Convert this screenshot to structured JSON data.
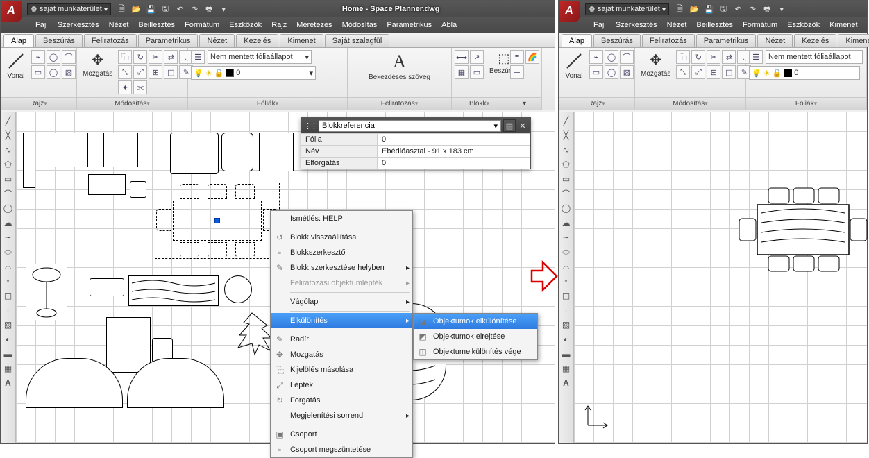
{
  "workspace_label": "saját munkaterület",
  "title": "Home - Space Planner.dwg",
  "menus": [
    "Fájl",
    "Szerkesztés",
    "Nézet",
    "Beillesztés",
    "Formátum",
    "Eszközök",
    "Rajz",
    "Méretezés",
    "Módosítás",
    "Parametrikus",
    "Abla"
  ],
  "menus_right": [
    "Fájl",
    "Szerkesztés",
    "Nézet",
    "Beillesztés",
    "Formátum",
    "Eszközök",
    "Kimenet"
  ],
  "tabs": [
    "Alap",
    "Beszúrás",
    "Feliratozás",
    "Parametrikus",
    "Nézet",
    "Kezelés",
    "Kimenet",
    "Saját szalagfül"
  ],
  "tabs_right": [
    "Alap",
    "Beszúrás",
    "Feliratozás",
    "Parametrikus",
    "Nézet",
    "Kezelés",
    "Kimenet"
  ],
  "panels": {
    "draw": "Rajz",
    "modify": "Módosítás",
    "layers": "Fóliák",
    "annot": "Feliratozás",
    "block": "Blokk",
    "line": "Vonal",
    "move": "Mozgatás",
    "text": "Bekezdéses szöveg",
    "insert": "Beszúrás",
    "layerstate_none": "Nem mentett fóliaállapot",
    "layer0": "0"
  },
  "props": {
    "title": "Blokkreferencia",
    "rows": [
      {
        "k": "Fólia",
        "v": "0"
      },
      {
        "k": "Név",
        "v": "Ebédlőasztal - 91 x 183 cm"
      },
      {
        "k": "Elforgatás",
        "v": "0"
      }
    ]
  },
  "ctx": {
    "repeat": "Ismétlés: HELP",
    "items1": [
      "Blokk visszaállítása",
      "Blokkszerkesztő",
      "Blokk szerkesztése helyben"
    ],
    "disabled": "Feliratozási objektumlépték",
    "clipboard": "Vágólap",
    "isolate": "Elkülönítés",
    "items2": [
      "Radír",
      "Mozgatás",
      "Kijelölés másolása",
      "Lépték",
      "Forgatás",
      "Megjelenítési sorrend"
    ],
    "items3": [
      "Csoport",
      "Csoport megszüntetése"
    ]
  },
  "submenu": {
    "items": [
      "Objektumok elkülönítése",
      "Objektumok elrejtése",
      "Objektumelkülönítés vége"
    ]
  }
}
